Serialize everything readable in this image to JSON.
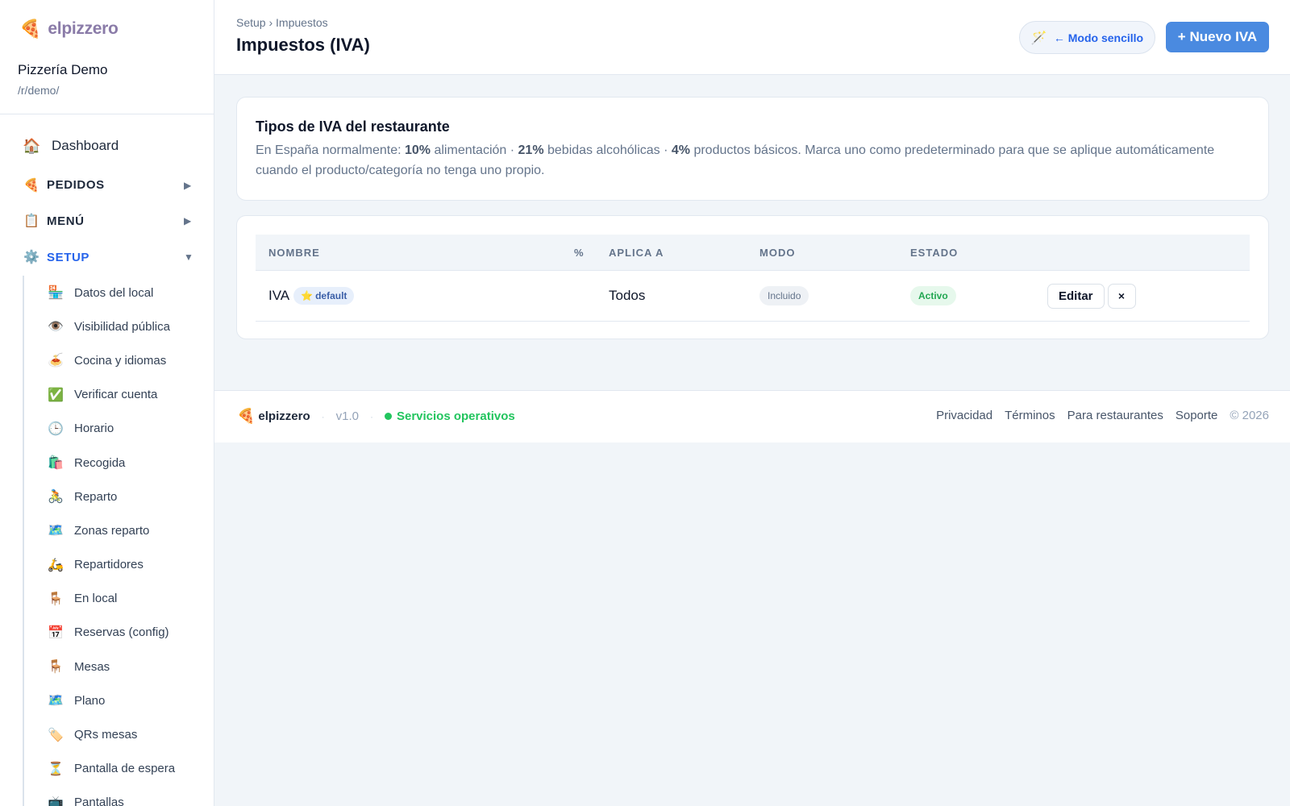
{
  "brand": {
    "icon": "🍕",
    "name": "elpizzero"
  },
  "restaurant": {
    "name": "Pizzería Demo",
    "path": "/r/demo/"
  },
  "nav": {
    "dashboard": {
      "icon": "🏠",
      "label": "Dashboard"
    },
    "groups": [
      {
        "icon": "🍕",
        "label": "PEDIDOS",
        "arrow": "▶"
      },
      {
        "icon": "📋",
        "label": "MENÚ",
        "arrow": "▶"
      },
      {
        "icon": "⚙️",
        "label": "SETUP",
        "arrow": "▼"
      }
    ],
    "setup_items": [
      {
        "icon": "🏪",
        "label": "Datos del local"
      },
      {
        "icon": "👁️",
        "label": "Visibilidad pública"
      },
      {
        "icon": "🍝",
        "label": "Cocina y idiomas"
      },
      {
        "icon": "✅",
        "label": "Verificar cuenta"
      },
      {
        "icon": "🕒",
        "label": "Horario"
      },
      {
        "icon": "🛍️",
        "label": "Recogida"
      },
      {
        "icon": "🚴",
        "label": "Reparto"
      },
      {
        "icon": "🗺️",
        "label": "Zonas reparto"
      },
      {
        "icon": "🛵",
        "label": "Repartidores"
      },
      {
        "icon": "🪑",
        "label": "En local"
      },
      {
        "icon": "📅",
        "label": "Reservas (config)"
      },
      {
        "icon": "🪑",
        "label": "Mesas"
      },
      {
        "icon": "🗺️",
        "label": "Plano"
      },
      {
        "icon": "🏷️",
        "label": "QRs mesas"
      },
      {
        "icon": "⏳",
        "label": "Pantalla de espera"
      },
      {
        "icon": "📺",
        "label": "Pantallas"
      }
    ]
  },
  "header": {
    "breadcrumb": "Setup › Impuestos",
    "title": "Impuestos (IVA)",
    "mode_button": {
      "icon": "🪄",
      "label": "← Modo sencillo"
    },
    "new_button": "+ Nuevo IVA"
  },
  "info": {
    "title": "Tipos de IVA del restaurante",
    "text_1": "En España normalmente: ",
    "rate_1": "10%",
    "text_2": " alimentación · ",
    "rate_2": "21%",
    "text_3": " bebidas alcohólicas · ",
    "rate_3": "4%",
    "text_4": " productos básicos. Marca uno como predeterminado para que se aplique automáticamente cuando el producto/categoría no tenga uno propio."
  },
  "table": {
    "columns": [
      "NOMBRE",
      "%",
      "APLICA A",
      "MODO",
      "ESTADO"
    ],
    "rows": [
      {
        "name": "IVA",
        "default_badge": {
          "icon": "⭐",
          "label": "default"
        },
        "percent": "",
        "applies_to": "Todos",
        "mode": "Incluido",
        "status": "Activo",
        "edit": "Editar",
        "delete": "×"
      }
    ]
  },
  "footer": {
    "logo_icon": "🍕",
    "logo_name": "elpizzero",
    "separator": "·",
    "version": "v1.0",
    "status": "Servicios operativos",
    "links": [
      "Privacidad",
      "Términos",
      "Para restaurantes",
      "Soporte"
    ],
    "copyright": "© 2026"
  },
  "colors": {
    "accent": "#4a8ae0",
    "active_nav": "#2563eb",
    "status_green": "#22c55e",
    "page_bg": "#f1f5f9"
  }
}
